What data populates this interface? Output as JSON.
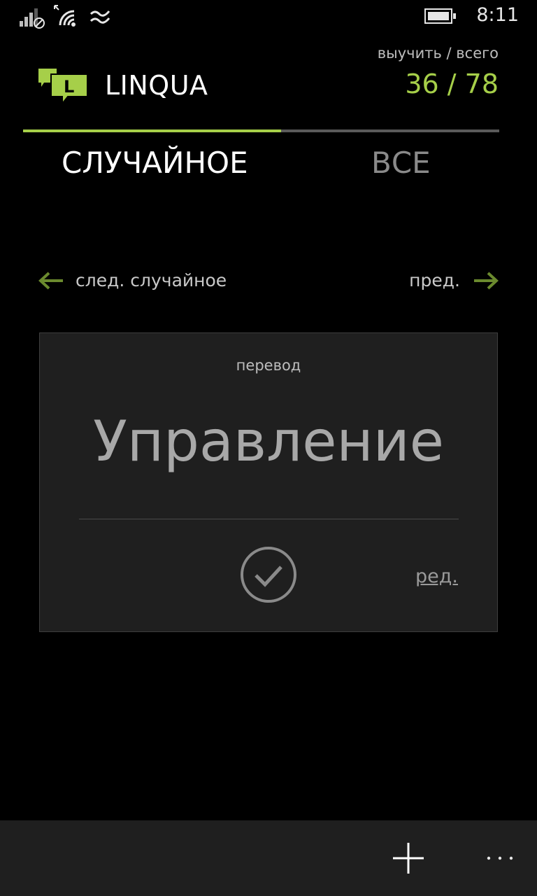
{
  "status_bar": {
    "time": "8:11",
    "icons": [
      "signal-icon",
      "wifi-icon",
      "cellular-data-icon",
      "battery-icon"
    ]
  },
  "header": {
    "app_name": "LINQUA",
    "logo_icon": "linqua-logo-icon",
    "progress_label": "выучить / всего",
    "progress_value": "36 / 78"
  },
  "pivot": {
    "tabs": [
      {
        "label": "СЛУЧАЙНОЕ",
        "active": true
      },
      {
        "label": "ВСЕ",
        "active": false
      }
    ]
  },
  "navigation": {
    "next_label": "след. случайное",
    "prev_label": "пред.",
    "next_icon": "arrow-left-icon",
    "prev_icon": "arrow-right-icon"
  },
  "card": {
    "caption": "перевод",
    "word": "Управление",
    "check_icon": "checkmark-circle-icon",
    "edit_label": "ред."
  },
  "app_bar": {
    "add_icon": "plus-icon",
    "more_icon": "more-icon"
  },
  "colors": {
    "accent": "#a6cf49",
    "arrow": "#6b8a2e",
    "card_bg": "#1f1f1f",
    "background": "#000000"
  }
}
